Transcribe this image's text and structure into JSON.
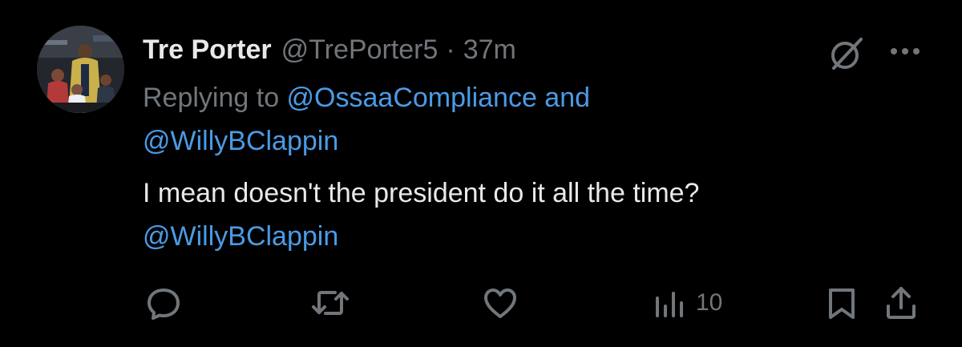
{
  "tweet": {
    "display_name": "Tre Porter",
    "handle": "@TrePorter5",
    "separator": "·",
    "time": "37m",
    "replying_prefix": "Replying to ",
    "replying_mention_1": "@OssaaCompliance",
    "replying_and": " and",
    "replying_mention_2": "@WillyBClappin",
    "text": "I mean doesn't the president do it all the time?",
    "text_mention": "@WillyBClappin"
  },
  "actions": {
    "views_count": "10"
  },
  "colors": {
    "background": "#000000",
    "primary_text": "#e7e9ea",
    "secondary_text": "#71767b",
    "link": "#4a9be6"
  },
  "icons": {
    "grok": "grok-icon",
    "more": "more-icon",
    "reply": "reply-icon",
    "retweet": "retweet-icon",
    "like": "heart-icon",
    "views": "views-icon",
    "bookmark": "bookmark-icon",
    "share": "share-icon"
  }
}
